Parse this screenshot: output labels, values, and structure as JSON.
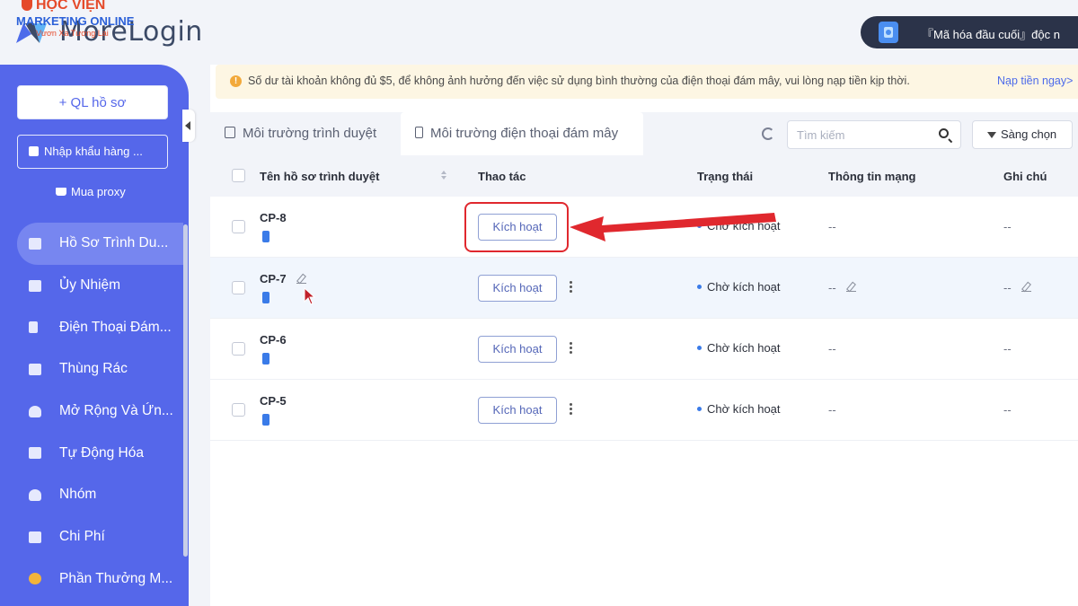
{
  "watermark": {
    "title": "HỌC VIỆN",
    "subtitle": "MARKETING ONLINE",
    "tagline": "Vươn Xa Tương Lai"
  },
  "app": {
    "logo_text": "MoreLogin"
  },
  "promo": {
    "text": "『Mã hóa đầu cuối』độc n"
  },
  "sidebar": {
    "new_profile_label": "+ QL hồ sơ",
    "import_label": "Nhập khẩu hàng ...",
    "buy_proxy_label": "Mua proxy",
    "items": [
      {
        "label": "Hồ Sơ Trình Du...",
        "icon": "browser-profile-icon",
        "active": true
      },
      {
        "label": "Ủy Nhiệm",
        "icon": "proxy-icon",
        "active": false
      },
      {
        "label": "Điện Thoại Đám...",
        "icon": "cloud-phone-icon",
        "active": false
      },
      {
        "label": "Thùng Rác",
        "icon": "trash-icon",
        "active": false
      },
      {
        "label": "Mở Rộng Và Ứn...",
        "icon": "puzzle-icon",
        "active": false
      },
      {
        "label": "Tự Động Hóa",
        "icon": "robot-icon",
        "active": false
      },
      {
        "label": "Nhóm",
        "icon": "group-icon",
        "active": false
      },
      {
        "label": "Chi Phí",
        "icon": "wallet-icon",
        "active": false
      },
      {
        "label": "Phần Thưởng M...",
        "icon": "coin-icon",
        "active": false
      }
    ]
  },
  "banner": {
    "text": "Số dư tài khoản không đủ $5, để không ảnh hưởng đến việc sử dụng bình thường của điện thoại đám mây, vui lòng nạp tiền kịp thời.",
    "link": "Nạp tiền ngay>",
    "color": "#fdf6e3"
  },
  "tabs": [
    {
      "label": "Môi trường trình duyệt",
      "active": false
    },
    {
      "label": "Môi trường điện thoại đám mây",
      "active": true
    }
  ],
  "search": {
    "placeholder": "Tìm kiếm",
    "value": ""
  },
  "filter_label": "Sàng chọn",
  "table": {
    "headers": {
      "name": "Tên hồ sơ trình duyệt",
      "action": "Thao tác",
      "status": "Trạng thái",
      "network": "Thông tin mạng",
      "note": "Ghi chú"
    },
    "rows": [
      {
        "name": "CP-8",
        "action": "Kích hoạt",
        "status": "Chờ kích hoạt",
        "network": "--",
        "note": "--"
      },
      {
        "name": "CP-7",
        "action": "Kích hoạt",
        "status": "Chờ kích hoạt",
        "network": "--",
        "note": "--"
      },
      {
        "name": "CP-6",
        "action": "Kích hoạt",
        "status": "Chờ kích hoạt",
        "network": "--",
        "note": "--"
      },
      {
        "name": "CP-5",
        "action": "Kích hoạt",
        "status": "Chờ kích hoạt",
        "network": "--",
        "note": "--"
      }
    ]
  },
  "colors": {
    "sidebar": "#5567ea",
    "accent": "#3a7be8",
    "annotation": "#e0282e"
  }
}
